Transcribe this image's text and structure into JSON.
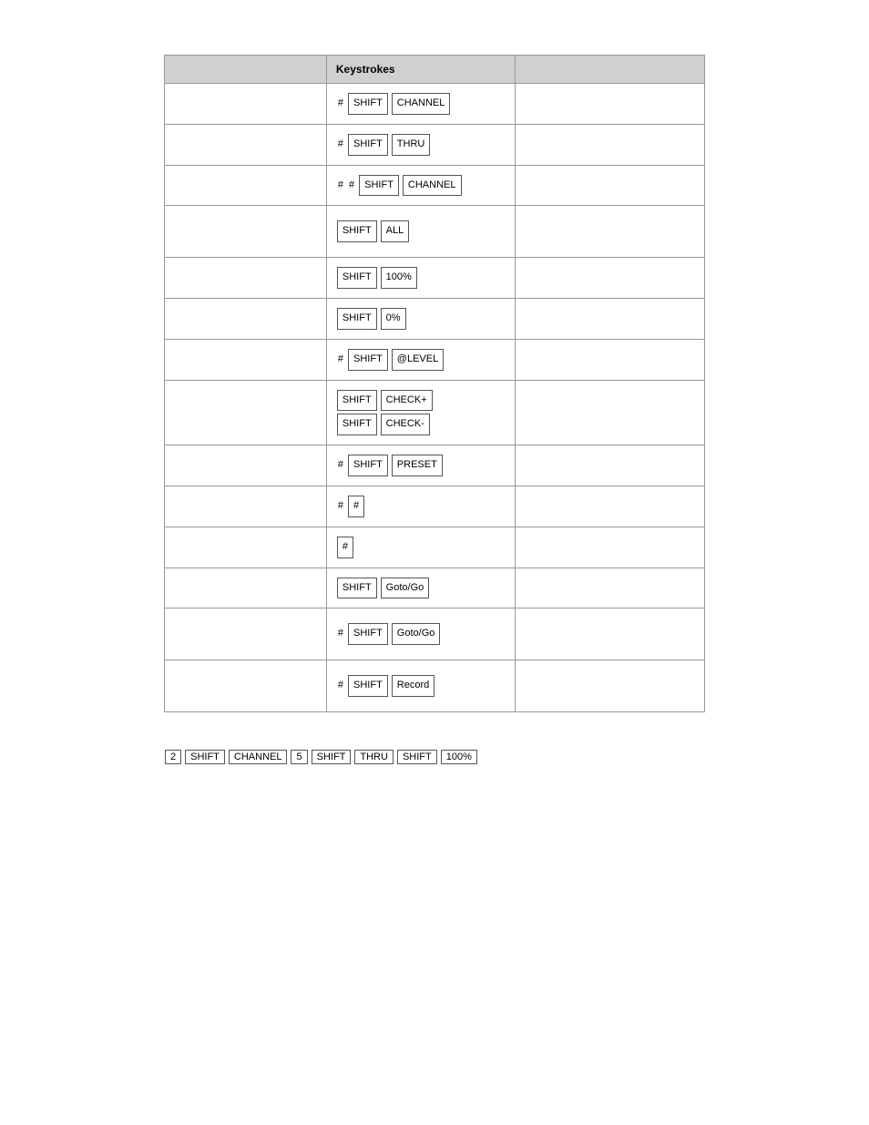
{
  "table": {
    "headers": [
      "",
      "Keystrokes",
      ""
    ],
    "rows": [
      {
        "col1": "",
        "col2_keys": [
          [
            {
              "text": "#",
              "plain": true
            },
            {
              "text": "SHIFT",
              "box": true
            },
            {
              "text": "CHANNEL",
              "box": true
            }
          ]
        ],
        "col3": ""
      },
      {
        "col1": "",
        "col2_keys": [
          [
            {
              "text": "#",
              "plain": true
            },
            {
              "text": "SHIFT",
              "box": true
            },
            {
              "text": "THRU",
              "box": true
            }
          ]
        ],
        "col3": ""
      },
      {
        "col1": "",
        "col2_keys": [
          [
            {
              "text": "#",
              "plain": true
            },
            {
              "text": "#",
              "plain": true
            },
            {
              "text": "SHIFT",
              "box": true
            },
            {
              "text": "CHANNEL",
              "box": true
            }
          ]
        ],
        "col3": ""
      },
      {
        "col1": "",
        "col2_keys": [
          [
            {
              "text": "SHIFT",
              "box": true
            },
            {
              "text": "ALL",
              "box": true
            }
          ]
        ],
        "col3": ""
      },
      {
        "col1": "",
        "col2_keys": [
          [
            {
              "text": "SHIFT",
              "box": true
            },
            {
              "text": "100%",
              "box": true
            }
          ]
        ],
        "col3": ""
      },
      {
        "col1": "",
        "col2_keys": [
          [
            {
              "text": "SHIFT",
              "box": true
            },
            {
              "text": "0%",
              "box": true
            }
          ]
        ],
        "col3": ""
      },
      {
        "col1": "",
        "col2_keys": [
          [
            {
              "text": "#",
              "plain": true
            },
            {
              "text": "SHIFT",
              "box": true
            },
            {
              "text": "@LEVEL",
              "box": true
            }
          ]
        ],
        "col3": ""
      },
      {
        "col1": "",
        "col2_keys": [
          [
            {
              "text": "SHIFT",
              "box": true
            },
            {
              "text": "CHECK+",
              "box": true
            }
          ],
          [
            {
              "text": "SHIFT",
              "box": true
            },
            {
              "text": "CHECK-",
              "box": true
            }
          ]
        ],
        "col3": ""
      },
      {
        "col1": "",
        "col2_keys": [
          [
            {
              "text": "#",
              "plain": true
            },
            {
              "text": "SHIFT",
              "box": true
            },
            {
              "text": "PRESET",
              "box": true
            }
          ]
        ],
        "col3": ""
      },
      {
        "col1": "",
        "col2_keys": [
          [
            {
              "text": "#",
              "plain": true
            },
            {
              "text": "#",
              "box": true
            }
          ]
        ],
        "col3": ""
      },
      {
        "col1": "",
        "col2_keys": [
          [
            {
              "text": "#",
              "box": true
            }
          ]
        ],
        "col3": ""
      },
      {
        "col1": "",
        "col2_keys": [
          [
            {
              "text": "SHIFT",
              "box": true
            },
            {
              "text": "Goto/Go",
              "box": true
            }
          ]
        ],
        "col3": ""
      },
      {
        "col1": "",
        "col2_keys": [
          [
            {
              "text": "#",
              "plain": true
            },
            {
              "text": "SHIFT",
              "box": true
            },
            {
              "text": "Goto/Go",
              "box": true
            }
          ]
        ],
        "col3": ""
      },
      {
        "col1": "",
        "col2_keys": [
          [
            {
              "text": "#",
              "plain": true
            },
            {
              "text": "SHIFT",
              "box": true
            },
            {
              "text": "Record",
              "box": true
            }
          ]
        ],
        "col3": ""
      }
    ]
  },
  "example": {
    "keys": [
      {
        "text": "2",
        "box": true
      },
      {
        "text": "SHIFT",
        "box": true
      },
      {
        "text": "CHANNEL",
        "box": true
      },
      {
        "text": "5",
        "box": true
      },
      {
        "text": "SHIFT",
        "box": true
      },
      {
        "text": "THRU",
        "box": true
      },
      {
        "text": "SHIFT",
        "box": true
      },
      {
        "text": "100%",
        "box": true
      }
    ]
  }
}
